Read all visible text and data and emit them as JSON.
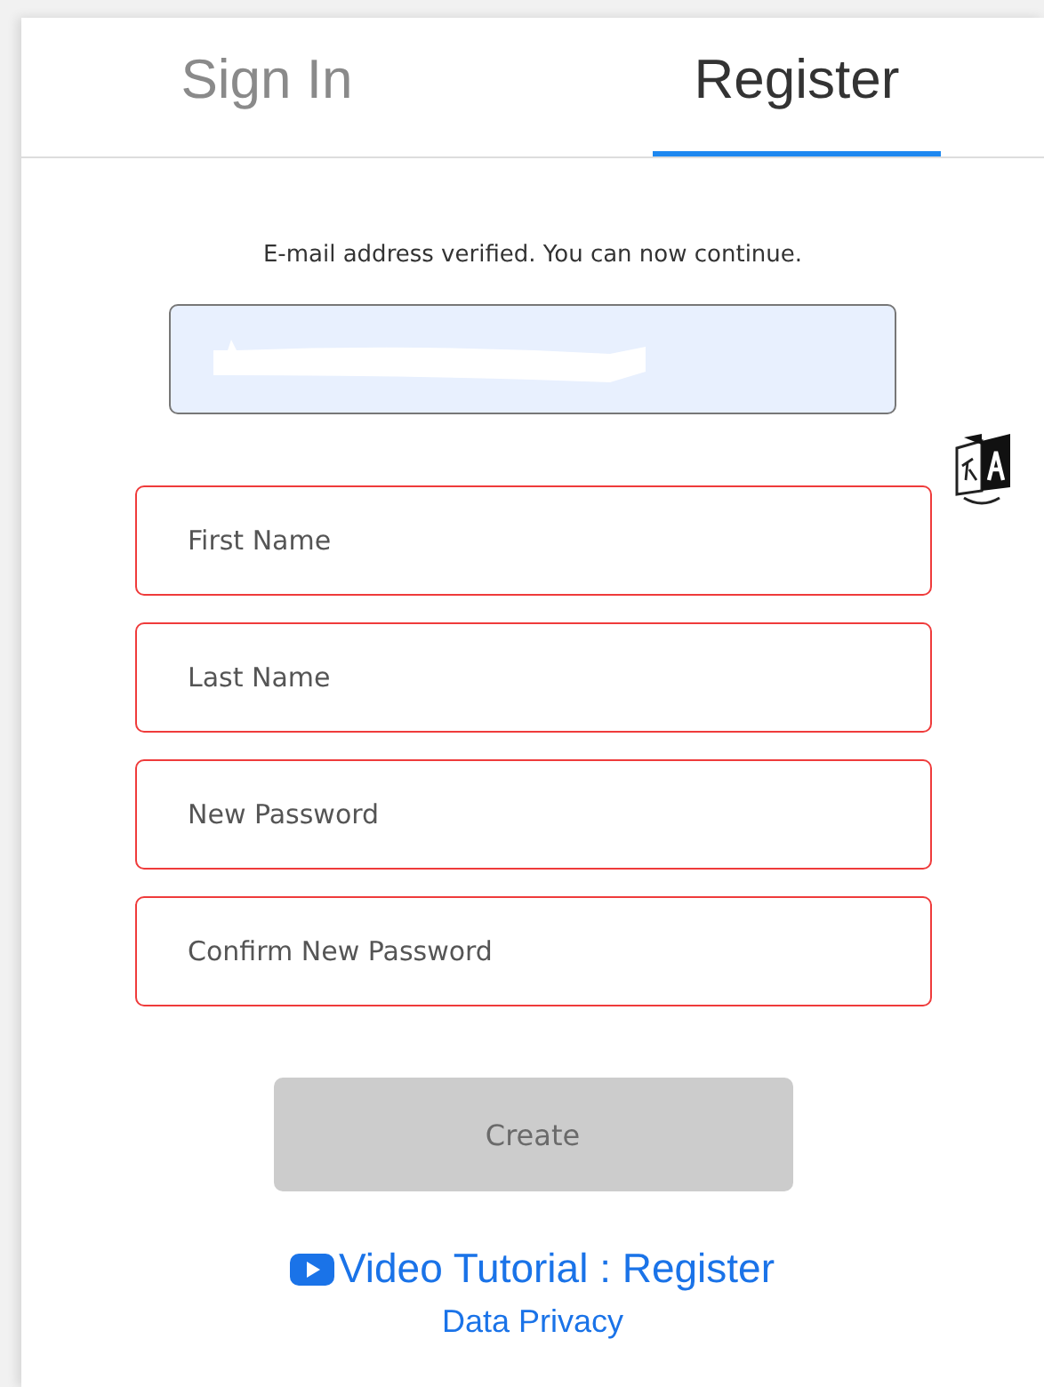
{
  "tabs": [
    {
      "label": "Sign In",
      "selected": false
    },
    {
      "label": "Register",
      "selected": true
    }
  ],
  "message": "E-mail address verified. You can now continue.",
  "email_field": {
    "redacted": true
  },
  "fields": [
    {
      "placeholder": "First Name",
      "invalid": true
    },
    {
      "placeholder": "Last Name",
      "invalid": true
    },
    {
      "placeholder": "New Password",
      "invalid": true
    },
    {
      "placeholder": "Confirm New Password",
      "invalid": true
    }
  ],
  "create_button": {
    "label": "Create",
    "disabled": true
  },
  "video_link": "Video Tutorial : Register",
  "privacy_link": "Data Privacy"
}
